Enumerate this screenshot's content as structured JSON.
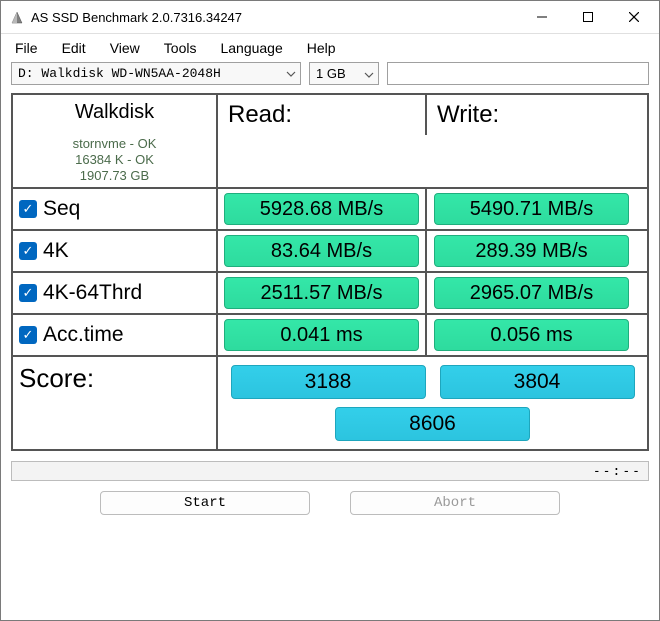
{
  "title": "AS SSD Benchmark 2.0.7316.34247",
  "menu": {
    "file": "File",
    "edit": "Edit",
    "view": "View",
    "tools": "Tools",
    "language": "Language",
    "help": "Help"
  },
  "toolbar": {
    "drive": "D: Walkdisk WD-WN5AA-2048H",
    "size": "1 GB"
  },
  "header": {
    "read": "Read:",
    "write": "Write:"
  },
  "drive": {
    "name": "Walkdisk",
    "driver": "stornvme - OK",
    "align": "16384 K - OK",
    "capacity": "1907.73 GB"
  },
  "tests": {
    "seq": {
      "label": "Seq",
      "read": "5928.68 MB/s",
      "write": "5490.71 MB/s"
    },
    "k4": {
      "label": "4K",
      "read": "83.64 MB/s",
      "write": "289.39 MB/s"
    },
    "k4t": {
      "label": "4K-64Thrd",
      "read": "2511.57 MB/s",
      "write": "2965.07 MB/s"
    },
    "acc": {
      "label": "Acc.time",
      "read": "0.041 ms",
      "write": "0.056 ms"
    }
  },
  "score": {
    "label": "Score:",
    "read": "3188",
    "write": "3804",
    "total": "8606"
  },
  "progress": {
    "dashes": "--:--"
  },
  "buttons": {
    "start": "Start",
    "abort": "Abort"
  }
}
